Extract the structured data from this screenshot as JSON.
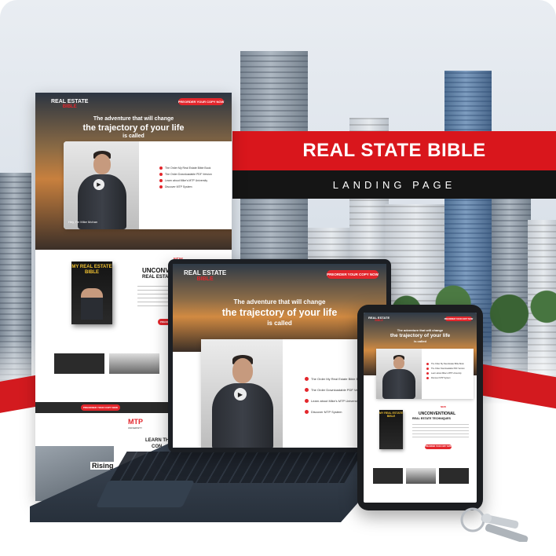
{
  "banner": {
    "title": "REAL STATE BIBLE",
    "subtitle": "LANDING PAGE"
  },
  "colors": {
    "accent_red": "#d9161c",
    "dark": "#151515",
    "white": "#ffffff"
  },
  "landing_page": {
    "logo_line1": "REAL ESTATE",
    "logo_line2": "BIBLE",
    "cta_label": "PREORDER YOUR COPY NOW",
    "headline_1": "The adventure that will change",
    "headline_2": "the trajectory of your life",
    "headline_3": "is called",
    "video_caption": "Hey, I'm Mike Mohan",
    "bullets": [
      "The Order My Real Estate Bible Book",
      "The Order Downloadable PDF Version",
      "Learn about Mike's MTP University",
      "Discover MTP System"
    ],
    "new_badge": "NEW",
    "section_title_1": "UNCONVENTIONAL",
    "section_title_2": "REAL ESTATE TECHNIQUES",
    "book_title_1": "MY REAL ESTATE",
    "book_title_2": "BIBLE",
    "university_logo": "MTP",
    "university_sub": "UNIVERSITY",
    "learn_text": "LEARN THE S",
    "learn_text_2": "CON",
    "rising_text": "Rising"
  },
  "icons": {
    "play": "play-icon",
    "bullet": "bullet-dot-icon",
    "keys": "keys-icon"
  }
}
